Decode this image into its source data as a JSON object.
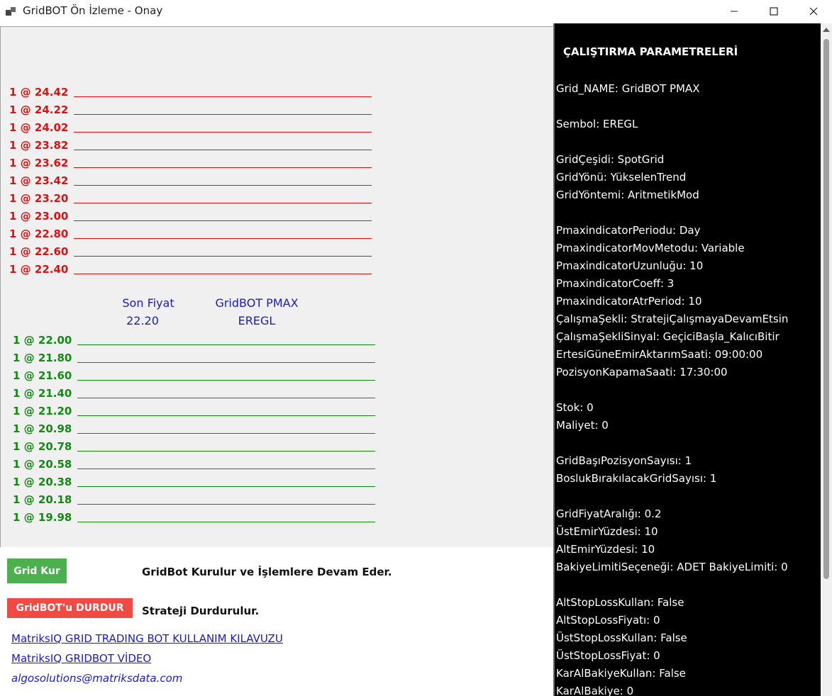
{
  "window": {
    "title": "GridBOT Ön İzleme - Onay",
    "icon": "app-window-icon",
    "controls": [
      "minimize-icon",
      "maximize-icon",
      "close-icon"
    ]
  },
  "sell_orders": [
    {
      "label": "1 @ 24.42"
    },
    {
      "label": "1 @ 24.22"
    },
    {
      "label": "1 @ 24.02"
    },
    {
      "label": "1 @ 23.82"
    },
    {
      "label": "1 @ 23.62"
    },
    {
      "label": "1 @ 23.42"
    },
    {
      "label": "1 @ 23.20"
    },
    {
      "label": "1 @ 23.00"
    },
    {
      "label": "1 @ 22.80"
    },
    {
      "label": "1 @ 22.60"
    },
    {
      "label": "1 @ 22.40"
    }
  ],
  "buy_orders": [
    {
      "label": "1 @ 22.00"
    },
    {
      "label": "1 @ 21.80"
    },
    {
      "label": "1 @ 21.60"
    },
    {
      "label": "1 @ 21.40"
    },
    {
      "label": "1 @ 21.20"
    },
    {
      "label": "1 @ 20.98"
    },
    {
      "label": "1 @ 20.78"
    },
    {
      "label": "1 @ 20.58"
    },
    {
      "label": "1 @ 20.38"
    },
    {
      "label": "1 @ 20.18"
    },
    {
      "label": "1 @ 19.98"
    }
  ],
  "info": {
    "last_price_label": "Son Fiyat",
    "last_price_value": "22.20",
    "bot_name": "GridBOT PMAX",
    "symbol": "EREGL"
  },
  "actions": {
    "grid_kur_label": "Grid Kur",
    "grid_kur_desc": "GridBot Kurulur ve İşlemlere Devam Eder.",
    "durdur_label": "GridBOT'u DURDUR",
    "durdur_desc": "Strateji Durdurulur."
  },
  "links": {
    "guide": "MatriksIQ GRID TRADING BOT KULLANIM KILAVUZU",
    "video": "MatriksIQ GRIDBOT VİDEO",
    "email": "algosolutions@matriksdata.com"
  },
  "params": {
    "title": "ÇALIŞTIRMA PARAMETRELERİ",
    "lines": [
      "Grid_NAME: GridBOT PMAX",
      "",
      "Sembol: EREGL",
      "",
      "GridÇeşidi: SpotGrid",
      "GridYönü: YükselenTrend",
      "GridYöntemi: AritmetikMod",
      "",
      "PmaxindicatorPeriodu: Day",
      "PmaxindicatorMovMetodu: Variable",
      "PmaxindicatorUzunluğu: 10",
      "PmaxindicatorCoeff: 3",
      "PmaxindicatorAtrPeriod: 10",
      "ÇalışmaŞekli: StratejiÇalışmayaDevamEtsin",
      "ÇalışmaŞekliSinyal: GeçiciBaşla_KalıcıBitir",
      "ErtesiGüneEmirAktarımSaati: 09:00:00",
      "PozisyonKapamaSaati: 17:30:00",
      "",
      "Stok: 0",
      "Maliyet: 0",
      "",
      "GridBaşıPozisyonSayısı: 1",
      "BoslukBırakılacakGridSayısı: 1",
      "",
      "GridFiyatAralığı: 0.2",
      "ÜstEmirYüzdesi: 10",
      "AltEmirYüzdesi: 10",
      "BakiyeLimitiSeçeneği: ADET  BakiyeLimiti: 0",
      "",
      "AltStopLossKullan: False",
      "AltStopLossFiyatı: 0",
      "ÜstStopLossKullan: False",
      "ÜstStopLossFiyat: 0",
      "KarAlBakiyeKullan: False",
      "KarAlBakiye: 0"
    ]
  },
  "colors": {
    "sell": "#e01010",
    "buy": "#138a13",
    "info": "#1a1ad0",
    "grid_kur_button": "#4caf50",
    "durdur_button": "#f04a42",
    "params_bg": "#000000"
  }
}
